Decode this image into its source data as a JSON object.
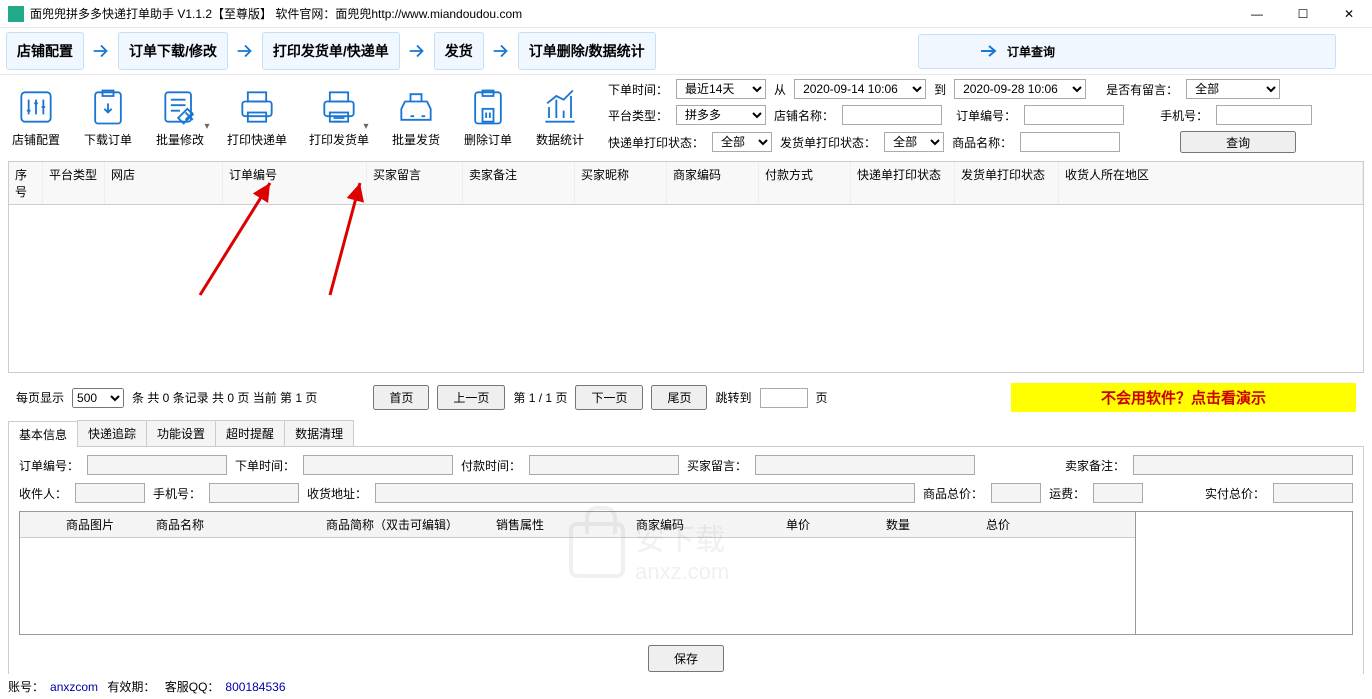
{
  "window": {
    "title": "面兜兜拼多多快递打单助手 V1.1.2【至尊版】    软件官网：面兜兜http://www.miandoudou.com"
  },
  "steps": {
    "s1": "店铺配置",
    "s2": "订单下载/修改",
    "s3": "打印发货单/快递单",
    "s4": "发货",
    "s5": "订单删除/数据统计",
    "query": "订单查询"
  },
  "toolbar": {
    "t1": "店铺配置",
    "t2": "下载订单",
    "t3": "批量修改",
    "t4": "打印快递单",
    "t5": "打印发货单",
    "t6": "批量发货",
    "t7": "删除订单",
    "t8": "数据统计"
  },
  "filters": {
    "order_time_label": "下单时间：",
    "order_time_value": "最近14天",
    "from_label": "从",
    "from_value": "2020-09-14 10:06",
    "to_label": "到",
    "to_value": "2020-09-28 10:06",
    "has_msg_label": "是否有留言：",
    "has_msg_value": "全部",
    "platform_label": "平台类型：",
    "platform_value": "拼多多",
    "shop_name_label": "店铺名称：",
    "order_no_label": "订单编号：",
    "phone_label": "手机号：",
    "express_print_label": "快递单打印状态：",
    "express_print_value": "全部",
    "ship_print_label": "发货单打印状态：",
    "ship_print_value": "全部",
    "goods_name_label": "商品名称：",
    "query_btn": "查询"
  },
  "columns": {
    "c1": "序号",
    "c2": "平台类型",
    "c3": "网店",
    "c4": "订单编号",
    "c5": "买家留言",
    "c6": "卖家备注",
    "c7": "买家昵称",
    "c8": "商家编码",
    "c9": "付款方式",
    "c10": "快递单打印状态",
    "c11": "发货单打印状态",
    "c12": "收货人所在地区"
  },
  "pager": {
    "per_page_label": "每页显示",
    "per_page_value": "500",
    "count_text": "条    共  0  条记录    共  0  页    当前  第  1  页",
    "first": "首页",
    "prev": "上一页",
    "page_info": "第 1 / 1 页",
    "next": "下一页",
    "last": "尾页",
    "jump_label": "跳转到",
    "page_suffix": "页",
    "demo": "不会用软件？点击看演示"
  },
  "tabs": {
    "t1": "基本信息",
    "t2": "快递追踪",
    "t3": "功能设置",
    "t4": "超时提醒",
    "t5": "数据清理"
  },
  "info": {
    "order_no": "订单编号：",
    "order_time": "下单时间：",
    "pay_time": "付款时间：",
    "buyer_msg": "买家留言：",
    "seller_note": "卖家备注：",
    "receiver": "收件人：",
    "phone": "手机号：",
    "address": "收货地址：",
    "goods_total": "商品总价：",
    "freight": "运费：",
    "paid_total": "实付总价："
  },
  "goods_cols": {
    "g1": "商品图片",
    "g2": "商品名称",
    "g3": "商品简称（双击可编辑）",
    "g4": "销售属性",
    "g5": "商家编码",
    "g6": "单价",
    "g7": "数量",
    "g8": "总价"
  },
  "save_btn": "保存",
  "status": {
    "account_label": "账号：",
    "account": "anxzcom",
    "expire_label": "有效期：",
    "qq_label": "客服QQ：",
    "qq": "800184536"
  },
  "watermark": {
    "text1": "安下载",
    "text2": "anxz.com"
  }
}
